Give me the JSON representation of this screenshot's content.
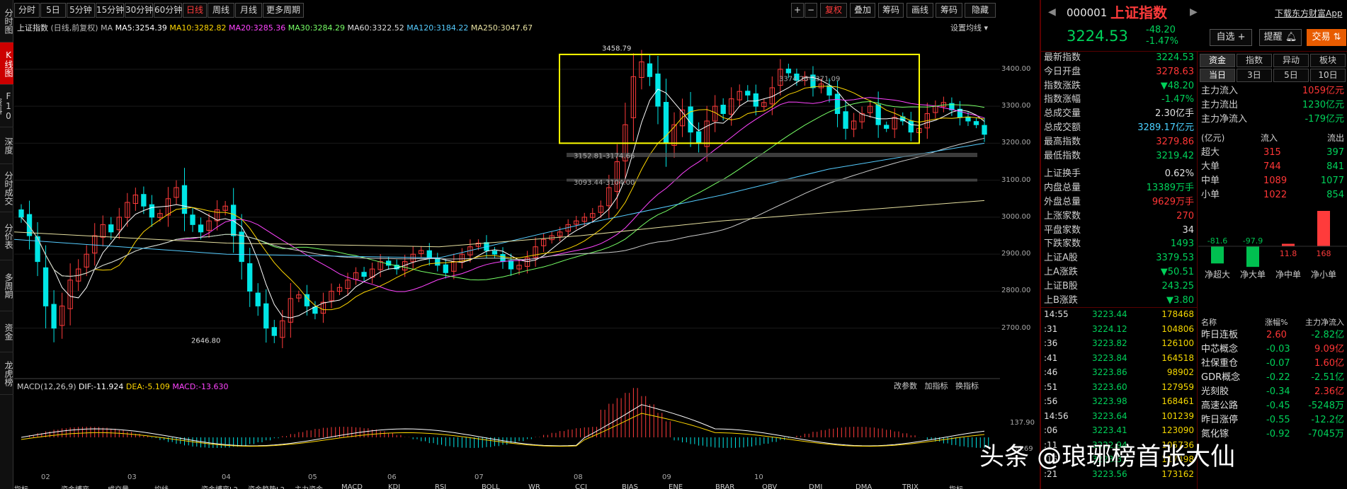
{
  "left_nav": [
    "分时图",
    "K线图",
    "F10资料",
    "深度F9",
    "分时成交",
    "分价表",
    "多周期",
    "资金",
    "龙虎榜"
  ],
  "toolbar": {
    "periods": [
      "分时",
      "5日",
      "5分钟",
      "15分钟",
      "30分钟",
      "60分钟",
      "日线",
      "周线",
      "月线",
      "更多周期"
    ],
    "active_period": "日线",
    "right": [
      "+",
      "−",
      "复权",
      "叠加",
      "筹码",
      "画线",
      "筹码",
      "隐藏"
    ]
  },
  "info": {
    "name": "上证指数",
    "mode": "(日线,前复权)",
    "ma_label": "MA",
    "ma5": "MA5:3254.39",
    "ma10": "MA10:3282.82",
    "ma20": "MA20:3285.36",
    "ma30": "MA30:3284.29",
    "ma60": "MA60:3322.52",
    "ma120": "MA120:3184.22",
    "ma250": "MA250:3047.67",
    "settings": "设置均线"
  },
  "price_axis": [
    "3400.00",
    "3300.00",
    "3200.00",
    "3100.00",
    "3000.00",
    "2900.00",
    "2800.00",
    "2700.00"
  ],
  "annotations": {
    "high": "3458.79",
    "low": "2646.80",
    "zone1": "3374.26-3371.09",
    "zone2": "3152.81-3174.66",
    "zone3": "3093.44-3104.00"
  },
  "macd": {
    "label": "MACD(12,26,9)",
    "dif": "DIF:-11.924",
    "dea": "DEA:-5.109",
    "macd": "MACD:-13.630",
    "btn1": "改参数",
    "btn2": "加指标",
    "btn3": "换指标",
    "axis": [
      "137.90",
      "64.69"
    ]
  },
  "months": [
    "02",
    "03",
    "04",
    "05",
    "06",
    "07",
    "08",
    "09",
    "10"
  ],
  "bottom_tabs": [
    "指标",
    "资金博弈",
    "成交量",
    "均线",
    "资金博弈L2",
    "资金趋势L2",
    "主力资金",
    "MACD",
    "KDJ",
    "RSI",
    "BOLL",
    "WR",
    "CCI",
    "BIAS",
    "ENE",
    "BRAR",
    "OBV",
    "DMI",
    "DMA",
    "TRIX",
    "指标"
  ],
  "quote": {
    "code": "000001",
    "name": "上证指数",
    "download": "下载东方财富App",
    "price": "3224.53",
    "change": "-48.20",
    "pct": "-1.47%",
    "buttons": [
      "自选 +",
      "提醒",
      "交易"
    ],
    "rows": [
      [
        "最新指数",
        "3224.53",
        "g"
      ],
      [
        "今日开盘",
        "3278.63",
        "r"
      ],
      [
        "指数涨跌",
        "▼48.20",
        "g"
      ],
      [
        "指数涨幅",
        "-1.47%",
        "g"
      ],
      [
        "总成交量",
        "2.30亿手",
        "w"
      ],
      [
        "总成交额",
        "3289.17亿元",
        "c"
      ],
      [
        "最高指数",
        "3279.86",
        "r"
      ],
      [
        "最低指数",
        "3219.42",
        "g"
      ],
      [
        "上证换手",
        "0.62%",
        "w"
      ],
      [
        "内盘总量",
        "13389万手",
        "g"
      ],
      [
        "外盘总量",
        "9629万手",
        "r"
      ],
      [
        "上涨家数",
        "270",
        "r"
      ],
      [
        "平盘家数",
        "34",
        "w"
      ],
      [
        "下跌家数",
        "1493",
        "g"
      ],
      [
        "上证A股",
        "3379.53",
        "g"
      ],
      [
        "上A涨跌",
        "▼50.51",
        "g"
      ],
      [
        "上证B股",
        "243.25",
        "g"
      ],
      [
        "上B涨跌",
        "▼3.80",
        "g"
      ]
    ],
    "ticks": [
      [
        "14:55",
        "3223.44",
        "178468"
      ],
      [
        ":31",
        "3224.12",
        "104806"
      ],
      [
        ":36",
        "3223.82",
        "126100"
      ],
      [
        ":41",
        "3223.84",
        "164518"
      ],
      [
        ":46",
        "3223.86",
        "98902"
      ],
      [
        ":51",
        "3223.60",
        "127959"
      ],
      [
        ":56",
        "3223.98",
        "168461"
      ],
      [
        "14:56",
        "3223.64",
        "101239"
      ],
      [
        ":06",
        "3223.41",
        "123090"
      ],
      [
        ":11",
        "3222.94",
        "105736"
      ],
      [
        ":16",
        "3223.31",
        "117498"
      ],
      [
        ":21",
        "3223.56",
        "173162"
      ]
    ]
  },
  "fund": {
    "tabs": [
      "资金",
      "指数",
      "异动",
      "板块"
    ],
    "subtabs": [
      "当日",
      "3日",
      "5日",
      "10日"
    ],
    "flows": [
      [
        "主力流入",
        "1059亿元",
        "r"
      ],
      [
        "主力流出",
        "1230亿元",
        "g"
      ],
      [
        "主力净流入",
        "-179亿元",
        "g"
      ]
    ],
    "header": [
      "(亿元)",
      "流入",
      "流出"
    ],
    "table": [
      [
        "超大",
        "315",
        "397"
      ],
      [
        "大单",
        "744",
        "841"
      ],
      [
        "中单",
        "1089",
        "1077"
      ],
      [
        "小单",
        "1022",
        "854"
      ]
    ],
    "bars": [
      [
        "-81.6",
        "净超大",
        -81.6
      ],
      [
        "-97.9",
        "净大单",
        -97.9
      ],
      [
        "11.8",
        "净中单",
        11.8
      ],
      [
        "168",
        "净小单",
        168
      ]
    ],
    "list_header": [
      "名称",
      "涨幅%",
      "主力净流入"
    ],
    "list": [
      [
        "昨日连板",
        "2.60",
        "-2.82亿"
      ],
      [
        "中芯概念",
        "-0.03",
        "9.09亿"
      ],
      [
        "社保重仓",
        "-0.07",
        "1.60亿"
      ],
      [
        "GDR概念",
        "-0.22",
        "-2.51亿"
      ],
      [
        "光刻胶",
        "-0.34",
        "2.36亿"
      ],
      [
        "高速公路",
        "-0.45",
        "-5248万"
      ],
      [
        "昨日涨停",
        "-0.55",
        "-12.2亿"
      ],
      [
        "氮化镓",
        "-0.92",
        "-7045万"
      ]
    ]
  },
  "watermark": "头条 @琅琊榜首张大仙",
  "chart_data": {
    "type": "candlestick",
    "title": "上证指数",
    "ylim": [
      2600,
      3480
    ],
    "close": [
      3000,
      2950,
      2880,
      2760,
      2700,
      2760,
      2830,
      2860,
      2900,
      2950,
      2980,
      2960,
      3000,
      3040,
      3060,
      3030,
      3000,
      3010,
      3050,
      3080,
      3010,
      2980,
      2960,
      2990,
      3020,
      3030,
      2950,
      2880,
      2800,
      2760,
      2700,
      2680,
      2720,
      2780,
      2790,
      2760,
      2740,
      2770,
      2800,
      2810,
      2830,
      2850,
      2840,
      2860,
      2880,
      2870,
      2860,
      2880,
      2900,
      2910,
      2890,
      2870,
      2850,
      2880,
      2900,
      2920,
      2930,
      2910,
      2900,
      2880,
      2860,
      2870,
      2890,
      2920,
      2940,
      2950,
      2960,
      2980,
      2990,
      3000,
      3010,
      3030,
      3080,
      3150,
      3250,
      3380,
      3420,
      3380,
      3300,
      3200,
      3250,
      3290,
      3230,
      3200,
      3260,
      3300,
      3280,
      3320,
      3340,
      3330,
      3300,
      3310,
      3350,
      3400,
      3390,
      3370,
      3380,
      3350,
      3360,
      3330,
      3280,
      3240,
      3260,
      3280,
      3300,
      3250,
      3240,
      3270,
      3260,
      3230,
      3240,
      3280,
      3300,
      3310,
      3290,
      3270,
      3260,
      3250,
      3224
    ]
  }
}
